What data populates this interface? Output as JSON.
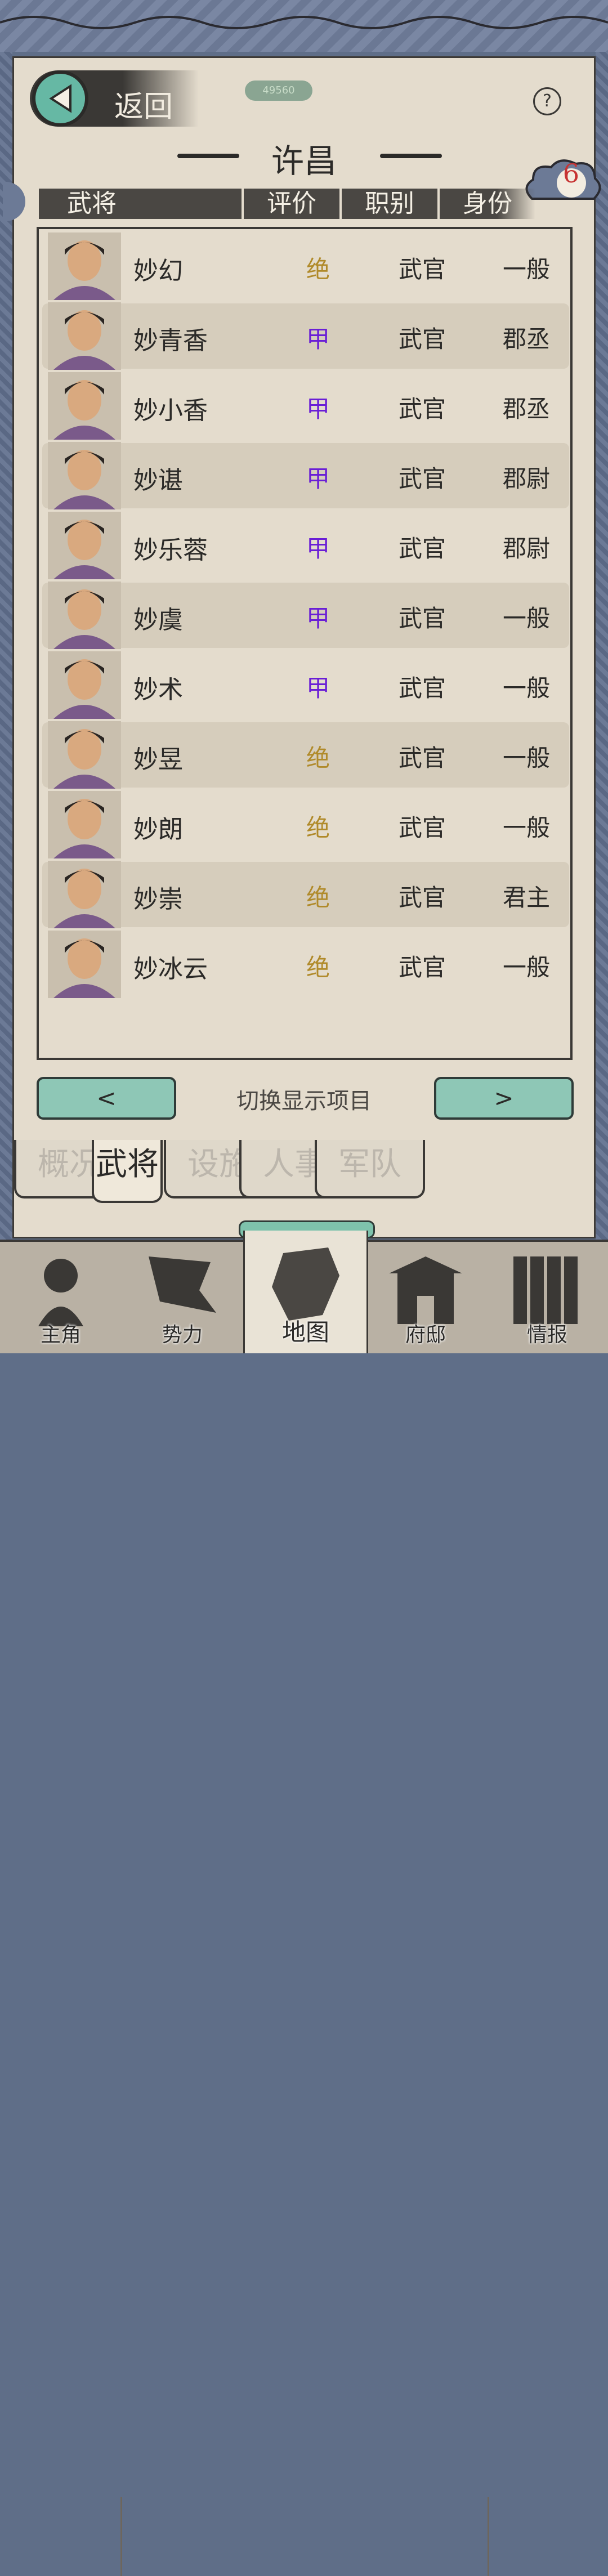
{
  "header": {
    "back_label": "返回",
    "pill_text": "49560",
    "help_symbol": "?",
    "city_name": "许昌",
    "badge_count": "6"
  },
  "table": {
    "columns": [
      "武将",
      "评价",
      "职别",
      "身份"
    ],
    "rows": [
      {
        "name": "妙幻",
        "rating": "绝",
        "post": "武官",
        "status": "一般"
      },
      {
        "name": "妙青香",
        "rating": "甲",
        "post": "武官",
        "status": "郡丞"
      },
      {
        "name": "妙小香",
        "rating": "甲",
        "post": "武官",
        "status": "郡丞"
      },
      {
        "name": "妙谌",
        "rating": "甲",
        "post": "武官",
        "status": "郡尉"
      },
      {
        "name": "妙乐蓉",
        "rating": "甲",
        "post": "武官",
        "status": "郡尉"
      },
      {
        "name": "妙虞",
        "rating": "甲",
        "post": "武官",
        "status": "一般"
      },
      {
        "name": "妙术",
        "rating": "甲",
        "post": "武官",
        "status": "一般"
      },
      {
        "name": "妙昱",
        "rating": "绝",
        "post": "武官",
        "status": "一般"
      },
      {
        "name": "妙朗",
        "rating": "绝",
        "post": "武官",
        "status": "一般"
      },
      {
        "name": "妙崇",
        "rating": "绝",
        "post": "武官",
        "status": "君主"
      },
      {
        "name": "妙冰云",
        "rating": "绝",
        "post": "武官",
        "status": "一般"
      }
    ]
  },
  "switcher": {
    "prev_label": "<",
    "label": "切换显示项目",
    "next_label": ">"
  },
  "tabs": [
    {
      "label": "概况"
    },
    {
      "label": "武将"
    },
    {
      "label": "设施"
    },
    {
      "label": "人事"
    },
    {
      "label": "军队"
    }
  ],
  "nav": [
    {
      "label": "主角"
    },
    {
      "label": "势力"
    },
    {
      "label": "地图"
    },
    {
      "label": "府邸"
    },
    {
      "label": "情报"
    }
  ],
  "colors": {
    "rating_jue": "#b08a2a",
    "rating_jia": "#6a1ed6",
    "accent_teal": "#8ec7b6",
    "badge_red": "#c73333"
  }
}
